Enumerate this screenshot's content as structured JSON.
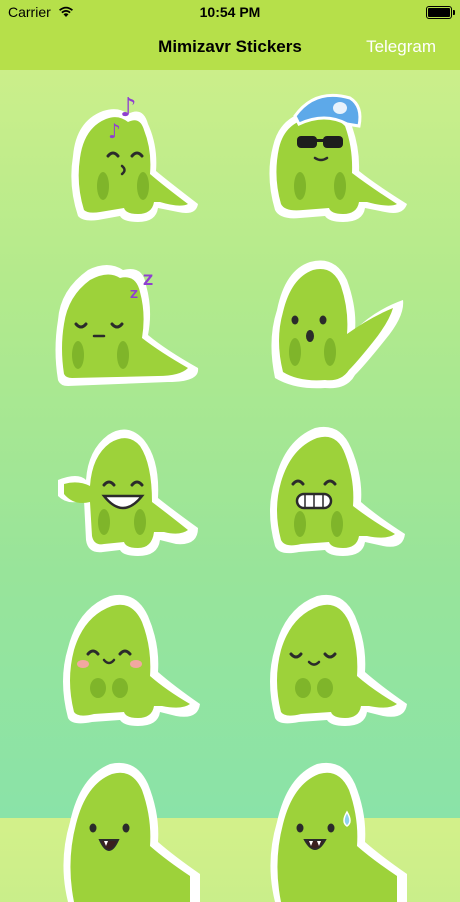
{
  "status_bar": {
    "carrier": "Carrier",
    "time": "10:54 PM",
    "wifi_icon": "wifi-icon",
    "battery_icon": "battery-icon"
  },
  "nav": {
    "title": "Mimizavr Stickers",
    "right_link": "Telegram"
  },
  "colors": {
    "bar": "#b6e04a",
    "body": "#9dd23a",
    "body_dark": "#7fb52a",
    "outline": "#ffffff",
    "accent_music": "#8f3fd0",
    "cap": "#5da9e9"
  },
  "stickers": [
    {
      "name": "music-singing"
    },
    {
      "name": "cap-sunglasses"
    },
    {
      "name": "sleeping"
    },
    {
      "name": "surprised"
    },
    {
      "name": "big-grin-wave"
    },
    {
      "name": "grin-teeth"
    },
    {
      "name": "blush-happy"
    },
    {
      "name": "calm-smile"
    },
    {
      "name": "open-mouth"
    },
    {
      "name": "nervous-sweat"
    }
  ]
}
